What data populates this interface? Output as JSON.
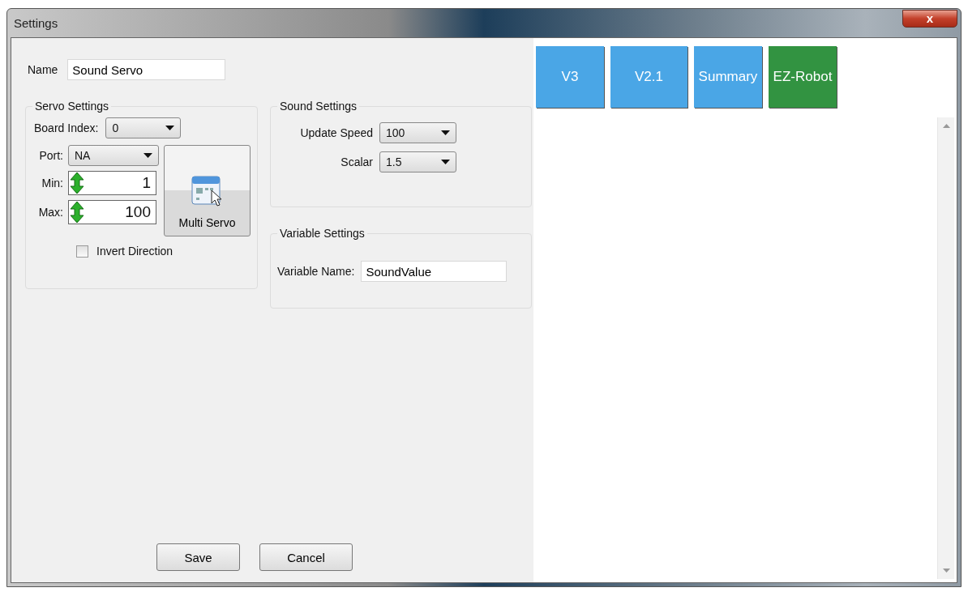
{
  "window": {
    "title": "Settings",
    "close": "x"
  },
  "name_field": {
    "label": "Name",
    "value": "Sound Servo"
  },
  "servo_settings": {
    "title": "Servo Settings",
    "board_index": {
      "label": "Board Index:",
      "value": "0"
    },
    "port": {
      "label": "Port:",
      "value": "NA"
    },
    "min": {
      "label": "Min:",
      "value": "1"
    },
    "max": {
      "label": "Max:",
      "value": "100"
    },
    "multi_servo_button": "Multi Servo",
    "invert_direction": {
      "label": "Invert Direction",
      "checked": false
    }
  },
  "sound_settings": {
    "title": "Sound Settings",
    "update_speed": {
      "label": "Update Speed",
      "value": "100"
    },
    "scalar": {
      "label": "Scalar",
      "value": "1.5"
    }
  },
  "variable_settings": {
    "title": "Variable Settings",
    "variable_name": {
      "label": "Variable Name:",
      "value": "SoundValue"
    }
  },
  "buttons": [
    "Save",
    "Cancel"
  ],
  "tabs": [
    {
      "label": "V3",
      "color": "#4aa6e6"
    },
    {
      "label": "V2.1",
      "color": "#4aa6e6"
    },
    {
      "label": "Summary",
      "color": "#4aa6e6"
    },
    {
      "label": "EZ-Robot",
      "color": "#329341"
    }
  ]
}
